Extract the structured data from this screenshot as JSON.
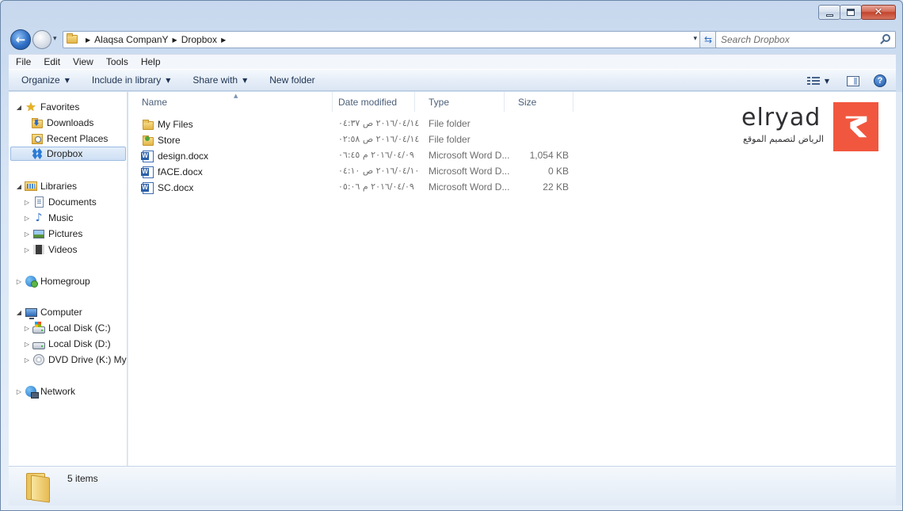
{
  "window": {
    "caption_buttons": {
      "minimize": "minimize",
      "maximize": "maximize",
      "close": "✕"
    }
  },
  "nav": {
    "back_icon": "←",
    "recent_icon": "▾",
    "breadcrumbs": [
      "Alaqsa CompanY",
      "Dropbox"
    ],
    "address_dropdown_icon": "▾",
    "refresh_icon": "⇆",
    "search": {
      "placeholder": "Search Dropbox"
    }
  },
  "menu": [
    "File",
    "Edit",
    "View",
    "Tools",
    "Help"
  ],
  "commands": {
    "organize": "Organize",
    "include_in_library": "Include in library",
    "share_with": "Share with",
    "new_folder": "New folder",
    "caret": "▼",
    "help": "?"
  },
  "sidebar": {
    "favorites": {
      "label": "Favorites",
      "items": [
        "Downloads",
        "Recent Places",
        "Dropbox"
      ]
    },
    "libraries": {
      "label": "Libraries",
      "items": [
        "Documents",
        "Music",
        "Pictures",
        "Videos"
      ]
    },
    "homegroup": {
      "label": "Homegroup"
    },
    "computer": {
      "label": "Computer",
      "items": [
        "Local Disk (C:)",
        "Local Disk (D:)",
        "DVD Drive (K:) My D"
      ]
    },
    "network": {
      "label": "Network"
    },
    "expanded_glyph": "◢",
    "collapsed_glyph": "▷"
  },
  "columns": {
    "name": "Name",
    "date": "Date modified",
    "type": "Type",
    "size": "Size",
    "sort_glyph": "▲"
  },
  "files": [
    {
      "name": "My Files",
      "date": "٢٠١٦/٠٤/١٤ ص ٠٤:٣٧",
      "type": "File folder",
      "size": "",
      "icon": "folder-icon"
    },
    {
      "name": "Store",
      "date": "٢٠١٦/٠٤/١٤ ص ٠٢:٥٨",
      "type": "File folder",
      "size": "",
      "icon": "store-folder-icon"
    },
    {
      "name": "design.docx",
      "date": "٢٠١٦/٠٤/٠٩ م ٠٦:٤٥",
      "type": "Microsoft Word D...",
      "size": "1,054 KB",
      "icon": "word-doc-icon"
    },
    {
      "name": "fACE.docx",
      "date": "٢٠١٦/٠٤/١٠ ص ٠٤:١٠",
      "type": "Microsoft Word D...",
      "size": "0 KB",
      "icon": "word-doc-icon"
    },
    {
      "name": "SC.docx",
      "date": "٢٠١٦/٠٤/٠٩ م ٠٥:٠٦",
      "type": "Microsoft Word D...",
      "size": "22 KB",
      "icon": "word-doc-icon"
    }
  ],
  "logo": {
    "word": "elryad",
    "tagline": "الرياض لتصميم الموقع",
    "accent": "#f1573f"
  },
  "details": {
    "item_count": "5 items"
  }
}
